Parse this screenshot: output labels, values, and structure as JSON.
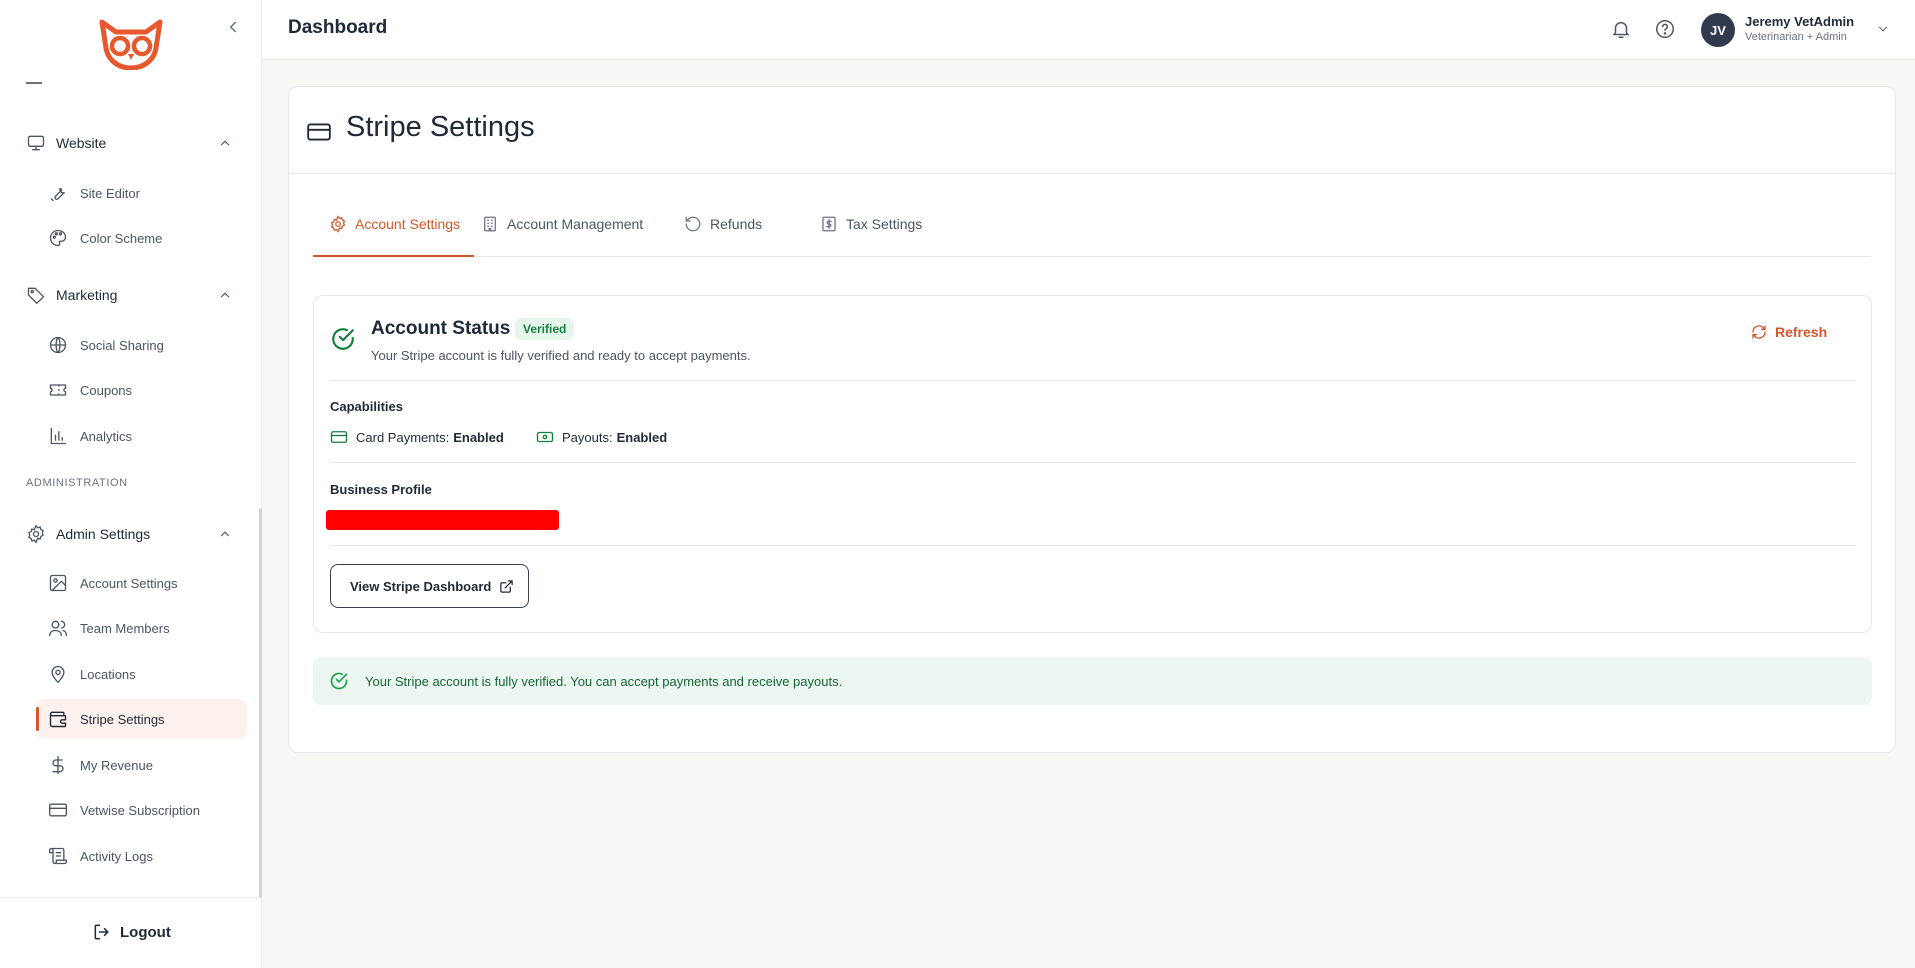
{
  "header": {
    "title": "Dashboard",
    "user": {
      "initials": "JV",
      "name": "Jeremy VetAdmin",
      "role": "Veterinarian + Admin"
    }
  },
  "sidebar": {
    "sections": {
      "website": {
        "label": "Website",
        "items": [
          {
            "label": "Site Editor",
            "icon": "wrench-icon"
          },
          {
            "label": "Color Scheme",
            "icon": "palette-icon"
          }
        ]
      },
      "marketing": {
        "label": "Marketing",
        "items": [
          {
            "label": "Social Sharing",
            "icon": "globe-icon"
          },
          {
            "label": "Coupons",
            "icon": "ticket-icon"
          },
          {
            "label": "Analytics",
            "icon": "bar-chart-icon"
          }
        ]
      },
      "admin_heading": "ADMINISTRATION",
      "admin": {
        "label": "Admin Settings",
        "items": [
          {
            "label": "Account Settings",
            "icon": "image-icon"
          },
          {
            "label": "Team Members",
            "icon": "users-icon"
          },
          {
            "label": "Locations",
            "icon": "map-pin-icon"
          },
          {
            "label": "Stripe Settings",
            "icon": "wallet-icon",
            "active": true
          },
          {
            "label": "My Revenue",
            "icon": "dollar-icon"
          },
          {
            "label": "Vetwise Subscription",
            "icon": "credit-card-icon"
          },
          {
            "label": "Activity Logs",
            "icon": "scroll-icon"
          }
        ]
      }
    },
    "logout": "Logout"
  },
  "page": {
    "title": "Stripe Settings",
    "tabs": [
      {
        "label": "Account Settings",
        "icon": "gear-icon",
        "active": true
      },
      {
        "label": "Account Management",
        "icon": "building-icon"
      },
      {
        "label": "Refunds",
        "icon": "rotate-ccw-icon"
      },
      {
        "label": "Tax Settings",
        "icon": "receipt-dollar-icon"
      }
    ],
    "status": {
      "title": "Account Status",
      "badge": "Verified",
      "description": "Your Stripe account is fully verified and ready to accept payments.",
      "refresh": "Refresh",
      "capabilities_label": "Capabilities",
      "capabilities": [
        {
          "label": "Card Payments:",
          "value": "Enabled"
        },
        {
          "label": "Payouts:",
          "value": "Enabled"
        }
      ],
      "business_profile_label": "Business Profile",
      "view_dashboard": "View Stripe Dashboard"
    },
    "alert": "Your Stripe account is fully verified. You can accept payments and receive payouts."
  },
  "colors": {
    "accent": "#d4572a",
    "success": "#15803d",
    "success_bg": "#ebf7f0",
    "redaction": "#ff0000"
  }
}
